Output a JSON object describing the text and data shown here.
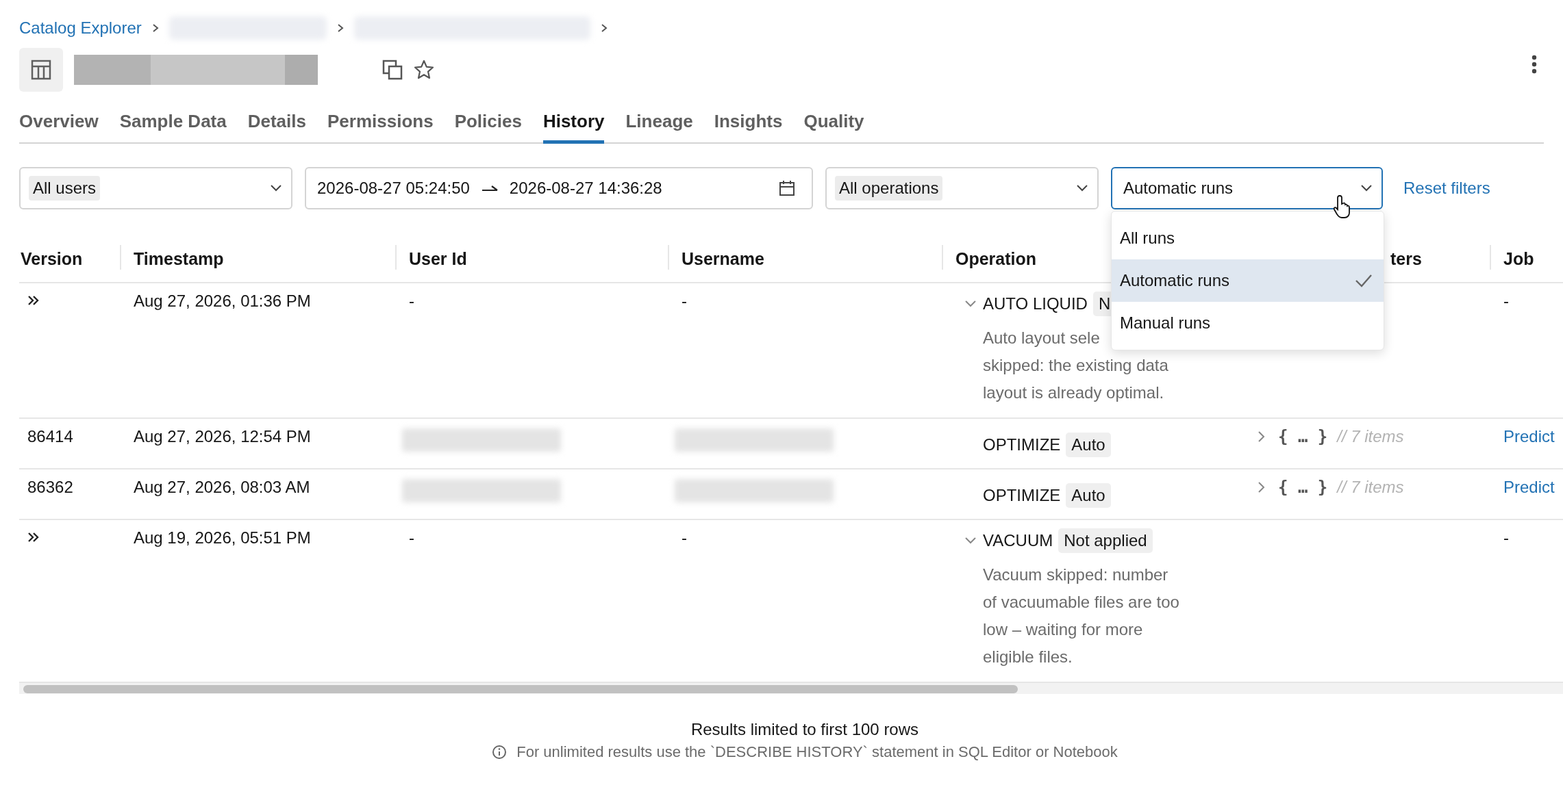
{
  "breadcrumb": {
    "root": "Catalog Explorer",
    "segments": [
      {
        "kind": "redacted"
      },
      {
        "kind": "redacted"
      }
    ]
  },
  "title": {
    "kind": "redacted",
    "starred": false
  },
  "tabs": [
    {
      "label": "Overview",
      "selected": false
    },
    {
      "label": "Sample Data",
      "selected": false
    },
    {
      "label": "Details",
      "selected": false
    },
    {
      "label": "Permissions",
      "selected": false
    },
    {
      "label": "Policies",
      "selected": false
    },
    {
      "label": "History",
      "selected": true
    },
    {
      "label": "Lineage",
      "selected": false
    },
    {
      "label": "Insights",
      "selected": false
    },
    {
      "label": "Quality",
      "selected": false
    }
  ],
  "filters": [
    {
      "kind": "select",
      "value": "All users",
      "chip": true,
      "focused": false
    },
    {
      "kind": "daterange",
      "from": "2026-08-27 05:24:50",
      "to": "2026-08-27 14:36:28"
    },
    {
      "kind": "select",
      "value": "All operations",
      "chip": true,
      "focused": false
    },
    {
      "kind": "select",
      "value": "Automatic runs",
      "chip": false,
      "focused": true
    }
  ],
  "reset_link": "Reset filters",
  "dropdown": {
    "options": [
      {
        "label": "All runs",
        "selected": false
      },
      {
        "label": "Automatic runs",
        "selected": true
      },
      {
        "label": "Manual runs",
        "selected": false
      }
    ]
  },
  "table": {
    "columns": [
      "Version",
      "Timestamp",
      "User Id",
      "Username",
      "Operation",
      "ters",
      "Job"
    ],
    "rows": [
      {
        "kind": "group",
        "timestamp": "Aug 27, 2026, 01:36 PM",
        "user_id": {
          "redacted": false,
          "text": "-"
        },
        "username": {
          "redacted": false,
          "text": "-"
        },
        "operation": {
          "name": "AUTO LIQUID",
          "tag": "N",
          "expanded": true,
          "description": [
            "Auto layout sele",
            "skipped: the existing data",
            "layout is already optimal."
          ]
        },
        "job": {
          "kind": "text",
          "text": "-"
        }
      },
      {
        "kind": "version",
        "version": "86414",
        "timestamp": "Aug 27, 2026, 12:54 PM",
        "user_id": {
          "redacted": true
        },
        "username": {
          "redacted": true
        },
        "operation": {
          "name": "OPTIMIZE",
          "tag": "Auto"
        },
        "parameters": {
          "expanded": false,
          "summary": "{ … }",
          "count": "// 7 items"
        },
        "job": {
          "kind": "link",
          "text": "Predict"
        }
      },
      {
        "kind": "version",
        "version": "86362",
        "timestamp": "Aug 27, 2026, 08:03 AM",
        "user_id": {
          "redacted": true
        },
        "username": {
          "redacted": true
        },
        "operation": {
          "name": "OPTIMIZE",
          "tag": "Auto"
        },
        "parameters": {
          "expanded": false,
          "summary": "{ … }",
          "count": "// 7 items"
        },
        "job": {
          "kind": "link",
          "text": "Predict"
        }
      },
      {
        "kind": "group",
        "timestamp": "Aug 19, 2026, 05:51 PM",
        "user_id": {
          "redacted": false,
          "text": "-"
        },
        "username": {
          "redacted": false,
          "text": "-"
        },
        "operation": {
          "name": "VACUUM",
          "tag": "Not applied",
          "expanded": true,
          "description": [
            "Vacuum skipped: number",
            "of vacuumable files are too",
            "low – waiting for more",
            "eligible files."
          ]
        },
        "job": {
          "kind": "text",
          "text": "-"
        }
      }
    ]
  },
  "footer": {
    "notice": "Results limited to first 100 rows",
    "hint": "For unlimited results use the `DESCRIBE HISTORY` statement in SQL Editor or Notebook"
  }
}
